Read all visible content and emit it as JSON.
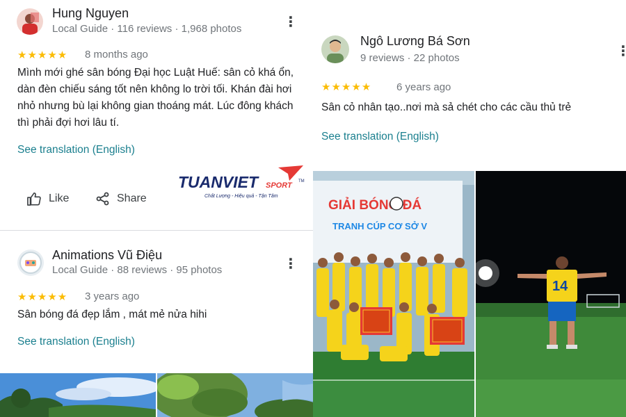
{
  "reviews": [
    {
      "author": "Hung Nguyen",
      "meta": "Local Guide · 116 reviews · 1,968 photos",
      "stars": "★★★★★",
      "rating": 5,
      "time": "8 months ago",
      "text": "Mình mới ghé sân bóng Đại học Luật Huế: sân cỏ khá ổn, dàn đèn chiếu sáng tốt nên không lo trời tối. Khán đài hơi nhỏ nhưng bù lại không gian thoáng mát. Lúc đông khách thì phải đợi hơi lâu tí.",
      "translation": "See translation (English)"
    },
    {
      "author": "Animations Vũ Điệu",
      "meta": "Local Guide · 88 reviews · 95 photos",
      "stars": "★★★★★",
      "rating": 5,
      "time": "3 years ago",
      "text": "Sân bóng đá đẹp lắm , mát mẻ nửa hihi",
      "translation": "See translation (English)"
    },
    {
      "author": "Ngô Lương Bá Sơn",
      "meta": "9 reviews · 22 photos",
      "stars": "★★★★★",
      "rating": 5,
      "time": "6 years ago",
      "text": "Sân cỏ nhân tạo..nơi mà sả chét cho các cầu thủ trẻ",
      "translation": "See translation (English)"
    }
  ],
  "actions": {
    "like": "Like",
    "share": "Share"
  },
  "logo": {
    "brand": "TUANVIET",
    "sub": "SPORT",
    "tm": "TM",
    "tagline": "Chất Lượng - Hiệu quả - Tận Tâm"
  },
  "banner": {
    "line1": "GIẢI BÓNG ĐÁ",
    "line2": "TRANH CÚP CƠ SỞ V"
  },
  "jersey_number": "14",
  "colors": {
    "star": "#fbbc04",
    "link": "#1a7f8e",
    "brand_navy": "#1a2b6d",
    "brand_red": "#e53935",
    "jersey_yellow": "#f5d31b"
  }
}
